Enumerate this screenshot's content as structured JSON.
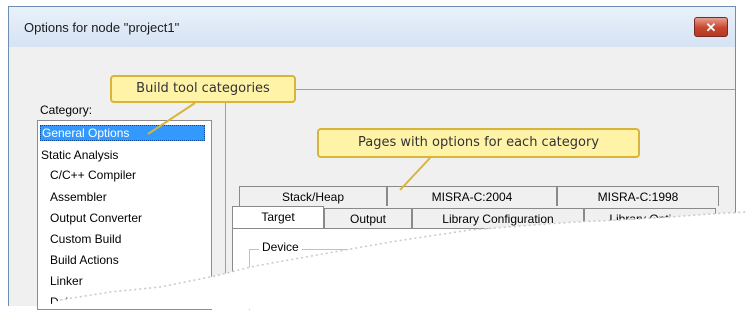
{
  "window": {
    "title": "Options for node \"project1\"",
    "close_glyph": "✕"
  },
  "category": {
    "label": "Category:",
    "items": [
      {
        "label": "General Options",
        "selected": true
      },
      {
        "label": "Static Analysis"
      },
      {
        "label": "C/C++ Compiler"
      },
      {
        "label": "Assembler"
      },
      {
        "label": "Output Converter"
      },
      {
        "label": "Custom Build"
      },
      {
        "label": "Build Actions"
      },
      {
        "label": "Linker"
      },
      {
        "label": "Debugger"
      }
    ]
  },
  "tabs": {
    "back_row": [
      "Stack/Heap",
      "MISRA-C:2004",
      "MISRA-C:1998"
    ],
    "front_row": [
      "Target",
      "Output",
      "Library Configuration",
      "Library Options"
    ]
  },
  "page": {
    "device_group_label": "Device"
  },
  "callouts": {
    "categories": "Build tool categories",
    "pages": "Pages with options for each category"
  },
  "colors": {
    "selection": "#3399ff",
    "callout_fill": "#fff3a8",
    "callout_border": "#d9b43a",
    "close_button": "#c7452f"
  }
}
